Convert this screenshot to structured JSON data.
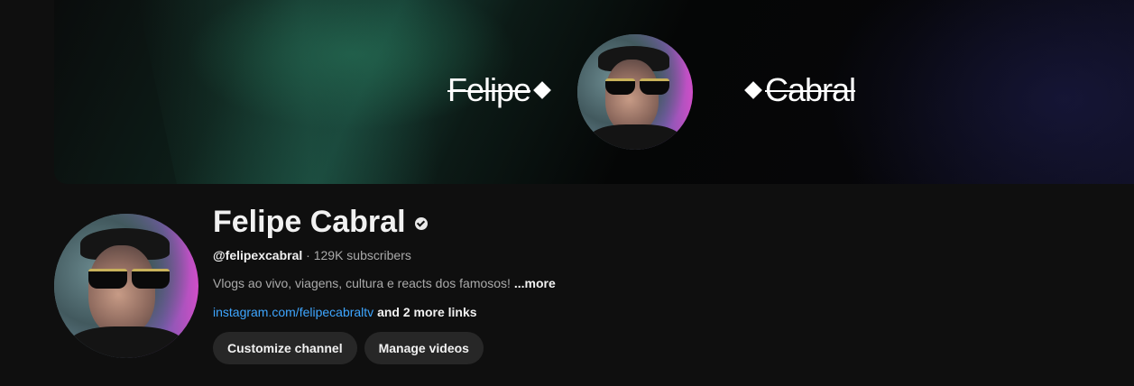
{
  "banner": {
    "first_name": "Felipe",
    "last_name": "Cabral"
  },
  "channel": {
    "name": "Felipe Cabral",
    "handle": "@felipexcabral",
    "separator": " · ",
    "subscribers": "129K subscribers",
    "description": "Vlogs ao vivo, viagens, cultura e reacts dos famosos!",
    "more_label": "...more",
    "link": "instagram.com/felipecabraltv",
    "more_links": "and 2 more links"
  },
  "actions": {
    "customize_label": "Customize channel",
    "manage_label": "Manage videos"
  },
  "colors": {
    "background": "#0f0f0f",
    "link": "#3ea6ff",
    "button_bg": "#272727",
    "secondary_text": "#aaaaaa"
  }
}
